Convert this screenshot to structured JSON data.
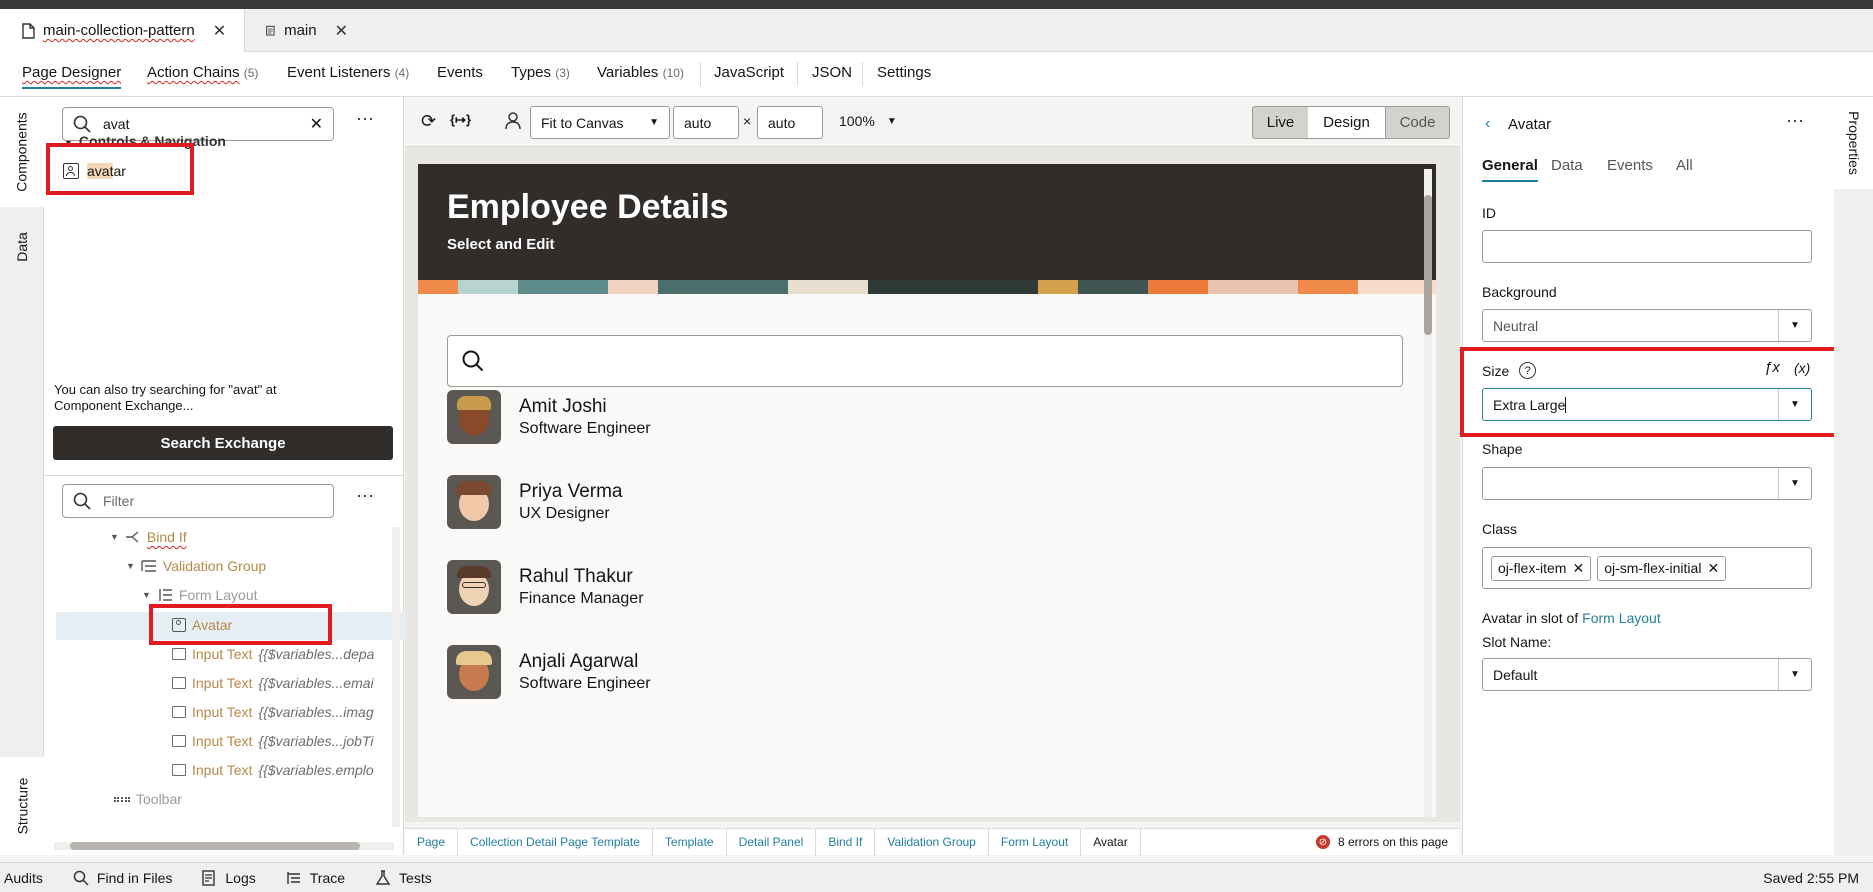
{
  "file_tabs": [
    {
      "label": "main-collection-pattern",
      "active": true
    },
    {
      "label": "main",
      "active": false
    }
  ],
  "designer_tabs": [
    {
      "label": "Page Designer",
      "count": ""
    },
    {
      "label": "Action Chains",
      "count": "(5)"
    },
    {
      "label": "Event Listeners",
      "count": "(4)"
    },
    {
      "label": "Events",
      "count": ""
    },
    {
      "label": "Types",
      "count": "(3)"
    },
    {
      "label": "Variables",
      "count": "(10)"
    },
    {
      "label": "JavaScript",
      "count": ""
    },
    {
      "label": "JSON",
      "count": ""
    },
    {
      "label": "Settings",
      "count": ""
    }
  ],
  "left_rail": {
    "components": "Components",
    "data": "Data",
    "structure": "Structure"
  },
  "components": {
    "search_value": "avat",
    "category": "Controls & Navigation",
    "result_label": "Avatar",
    "exchange_hint": "You can also try searching for \"avat\" at Component Exchange...",
    "search_exchange_button": "Search Exchange"
  },
  "structure": {
    "filter_placeholder": "Filter",
    "rows": [
      {
        "label": "Bind If",
        "expr": ""
      },
      {
        "label": "Validation Group",
        "expr": ""
      },
      {
        "label": "Form Layout",
        "expr": ""
      },
      {
        "label": "Avatar",
        "expr": ""
      },
      {
        "label": "Input Text",
        "expr": "{{$variables...depa"
      },
      {
        "label": "Input Text",
        "expr": "{{$variables...emai"
      },
      {
        "label": "Input Text",
        "expr": "{{$variables...imag"
      },
      {
        "label": "Input Text",
        "expr": "{{$variables...jobTi"
      },
      {
        "label": "Input Text",
        "expr": "{{$variables.emplo"
      },
      {
        "label": "Toolbar",
        "expr": ""
      }
    ]
  },
  "canvas_toolbar": {
    "fit_label": "Fit to Canvas",
    "width_value": "auto",
    "times": "×",
    "height_value": "auto",
    "zoom": "100%",
    "modes": [
      "Live",
      "Design",
      "Code"
    ]
  },
  "preview": {
    "title": "Employee Details",
    "subtitle": "Select and Edit",
    "employees": [
      {
        "name": "Amit Joshi",
        "role": "Software Engineer"
      },
      {
        "name": "Priya Verma",
        "role": "UX Designer"
      },
      {
        "name": "Rahul Thakur",
        "role": "Finance Manager"
      },
      {
        "name": "Anjali Agarwal",
        "role": "Software Engineer"
      }
    ]
  },
  "breadcrumbs": [
    "Page",
    "Collection Detail Page Template",
    "Template",
    "Detail Panel",
    "Bind If",
    "Validation Group",
    "Form Layout",
    "Avatar"
  ],
  "errors_text": "8 errors on this page",
  "properties": {
    "title": "Avatar",
    "tabs": [
      "General",
      "Data",
      "Events",
      "All"
    ],
    "id_label": "ID",
    "id_value": "",
    "background_label": "Background",
    "background_value": "Neutral",
    "size_label": "Size",
    "fx_label": "ƒx",
    "var_label": "(x)",
    "size_value": "Extra Large",
    "shape_label": "Shape",
    "shape_value": "",
    "class_label": "Class",
    "class_chips": [
      "oj-flex-item",
      "oj-sm-flex-initial"
    ],
    "slot_prefix": "Avatar in slot of",
    "slot_link": "Form Layout",
    "slot_name_label": "Slot Name:",
    "slot_name_value": "Default"
  },
  "right_rail": {
    "properties": "Properties"
  },
  "status_bar": {
    "items": [
      "Audits",
      "Find in Files",
      "Logs",
      "Trace",
      "Tests"
    ],
    "saved": "Saved 2:55 PM"
  },
  "colors": {
    "accent": "#227e9e",
    "highlight": "#e11b22",
    "hero": "#312d2a",
    "tree_label": "#b5894a"
  }
}
